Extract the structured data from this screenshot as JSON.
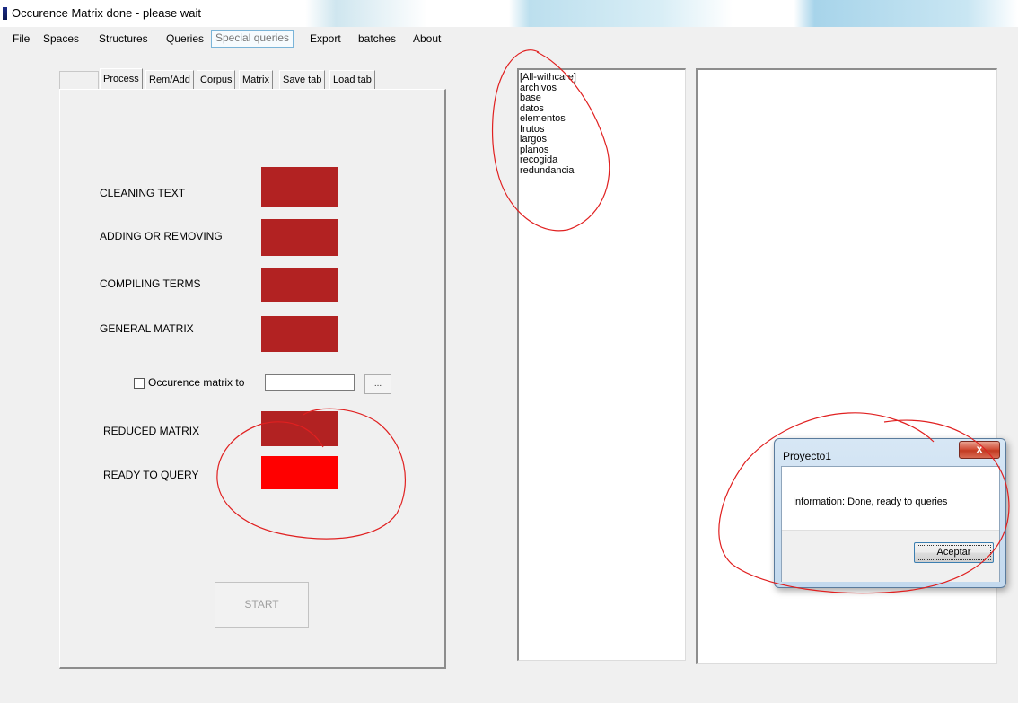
{
  "window": {
    "title": "Occurence Matrix done - please wait"
  },
  "menu": {
    "items": [
      {
        "label": "File"
      },
      {
        "label": "Spaces"
      },
      {
        "label": "Structures"
      },
      {
        "label": "Queries"
      },
      {
        "label": "Special queries"
      },
      {
        "label": "Export"
      },
      {
        "label": "batches"
      },
      {
        "label": "About"
      }
    ],
    "active_index": 4
  },
  "tabs": {
    "items": [
      {
        "label": "Process"
      },
      {
        "label": "Rem/Add"
      },
      {
        "label": "Corpus"
      },
      {
        "label": "Matrix"
      },
      {
        "label": "Save tab"
      },
      {
        "label": "Load tab"
      }
    ],
    "selected_index": 0
  },
  "process": {
    "steps": [
      {
        "label": "CLEANING TEXT",
        "status": "done"
      },
      {
        "label": "ADDING OR REMOVING",
        "status": "done"
      },
      {
        "label": "COMPILING TERMS",
        "status": "done"
      },
      {
        "label": "GENERAL MATRIX",
        "status": "done"
      },
      {
        "label": "REDUCED MATRIX",
        "status": "done"
      },
      {
        "label": "READY TO QUERY",
        "status": "ready"
      }
    ],
    "occurrence": {
      "checkbox_label": "Occurence matrix to",
      "checked": false,
      "path_value": "",
      "browse_label": "..."
    },
    "start_label": "START",
    "start_enabled": false
  },
  "terms": {
    "items": [
      "[All-withcare]",
      "archivos",
      "base",
      "datos",
      "elementos",
      "frutos",
      "largos",
      "planos",
      "recogida",
      "redundancia"
    ]
  },
  "dialog": {
    "title": "Proyecto1",
    "close_label": "x",
    "message": "Information: Done, ready to queries",
    "ok_label": "Aceptar"
  },
  "colors": {
    "indicator_done": "#b22222",
    "indicator_ready": "#ff0000",
    "annotation_ink": "#e02020"
  }
}
